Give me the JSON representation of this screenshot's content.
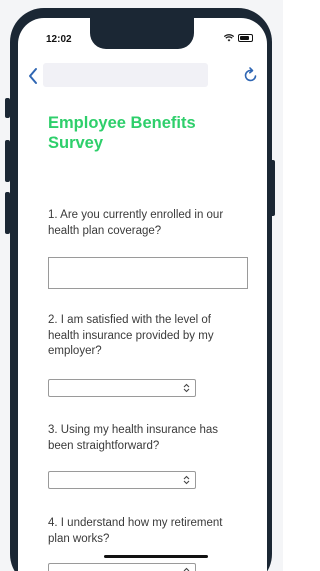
{
  "status_bar": {
    "time": "12:02",
    "icons": [
      "wifi-icon",
      "battery-icon"
    ]
  },
  "nav": {
    "back_icon": "chevron-left-icon",
    "url_text": "",
    "refresh_icon": "refresh-icon",
    "accent_color": "#2f66b3"
  },
  "survey": {
    "title_line1": "Employee Benefits",
    "title_line2": "Survey",
    "title_color": "#2ecf6b",
    "questions": [
      {
        "line1": "1. Are you currently enrolled in our",
        "line2": "health plan coverage?",
        "line3": "",
        "answer_type": "text",
        "value": ""
      },
      {
        "line1": "2. I am satisfied with the level of",
        "line2": "health insurance provided by my",
        "line3": "employer?",
        "answer_type": "select",
        "value": ""
      },
      {
        "line1": "3. Using my health insurance has",
        "line2": "been straightforward?",
        "line3": "",
        "answer_type": "select",
        "value": ""
      },
      {
        "line1": "4. I understand how my retirement",
        "line2": "plan works?",
        "line3": "",
        "answer_type": "select",
        "value": ""
      }
    ]
  }
}
